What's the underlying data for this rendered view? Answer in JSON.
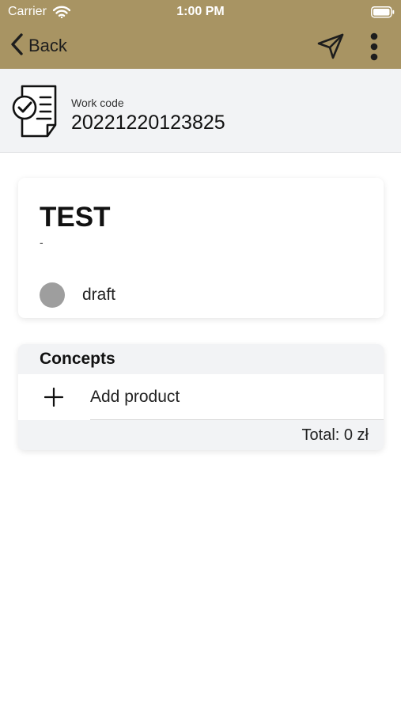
{
  "status_bar": {
    "carrier": "Carrier",
    "time": "1:00 PM",
    "wifi_icon": "wifi-icon",
    "battery_icon": "battery-icon"
  },
  "nav": {
    "back_label": "Back",
    "back_icon": "chevron-left-icon",
    "send_icon": "send-icon",
    "more_icon": "more-vertical-icon",
    "bar_color": "#a89463"
  },
  "work": {
    "icon": "document-check-icon",
    "label": "Work code",
    "value": "20221220123825"
  },
  "order": {
    "title": "TEST",
    "subtitle": "-",
    "status": "draft",
    "status_color": "#9e9e9e"
  },
  "concepts": {
    "header": "Concepts",
    "add_label": "Add product",
    "add_icon": "plus-icon",
    "total": "Total: 0 zł"
  }
}
